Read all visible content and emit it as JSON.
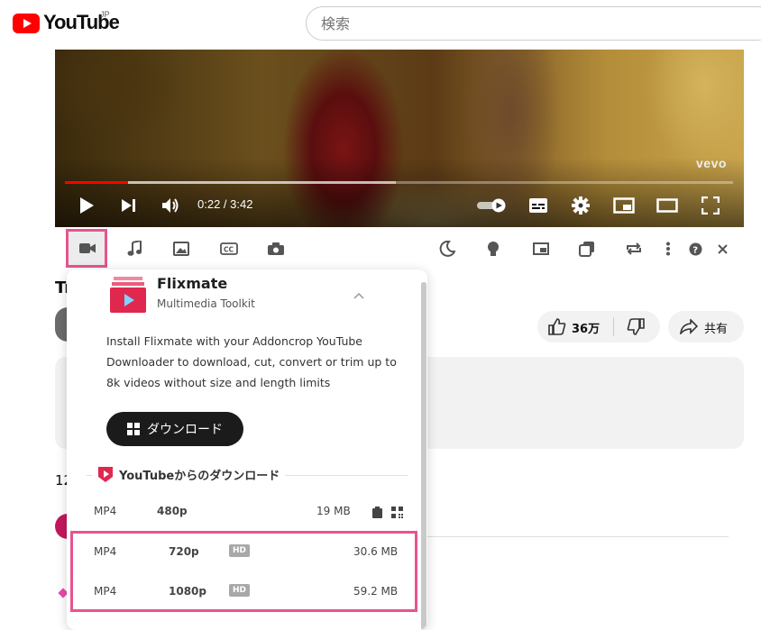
{
  "header": {
    "logo_text": "YouTube",
    "region": "JP",
    "search_placeholder": "検索"
  },
  "player": {
    "watermark": "vevo",
    "time": "0:22 / 3:42",
    "progress_played": 0.095,
    "progress_buffered": 0.495
  },
  "page": {
    "title_fragment": "Tr",
    "like_count": "36万",
    "share_label": "共有",
    "comment_count_fragment": "12"
  },
  "flixmate": {
    "name": "Flixmate",
    "subtitle": "Multimedia Toolkit",
    "description": "Install Flixmate with your Addoncrop YouTube Downloader to download, cut, convert or trim up to 8k videos without size and length limits",
    "download_label": "ダウンロード",
    "section_title": "YouTubeからのダウンロード",
    "downloads": [
      {
        "format": "MP4",
        "quality": "480p",
        "badge": "",
        "size": "19 MB"
      },
      {
        "format": "MP4",
        "quality": "720p",
        "badge": "HD",
        "size": "30.6 MB"
      },
      {
        "format": "MP4",
        "quality": "1080p",
        "badge": "HD",
        "size": "59.2 MB"
      }
    ]
  },
  "colors": {
    "brand_red": "#ff0000",
    "highlight_pink": "#e6558f",
    "flixmate_red": "#e0284f"
  }
}
